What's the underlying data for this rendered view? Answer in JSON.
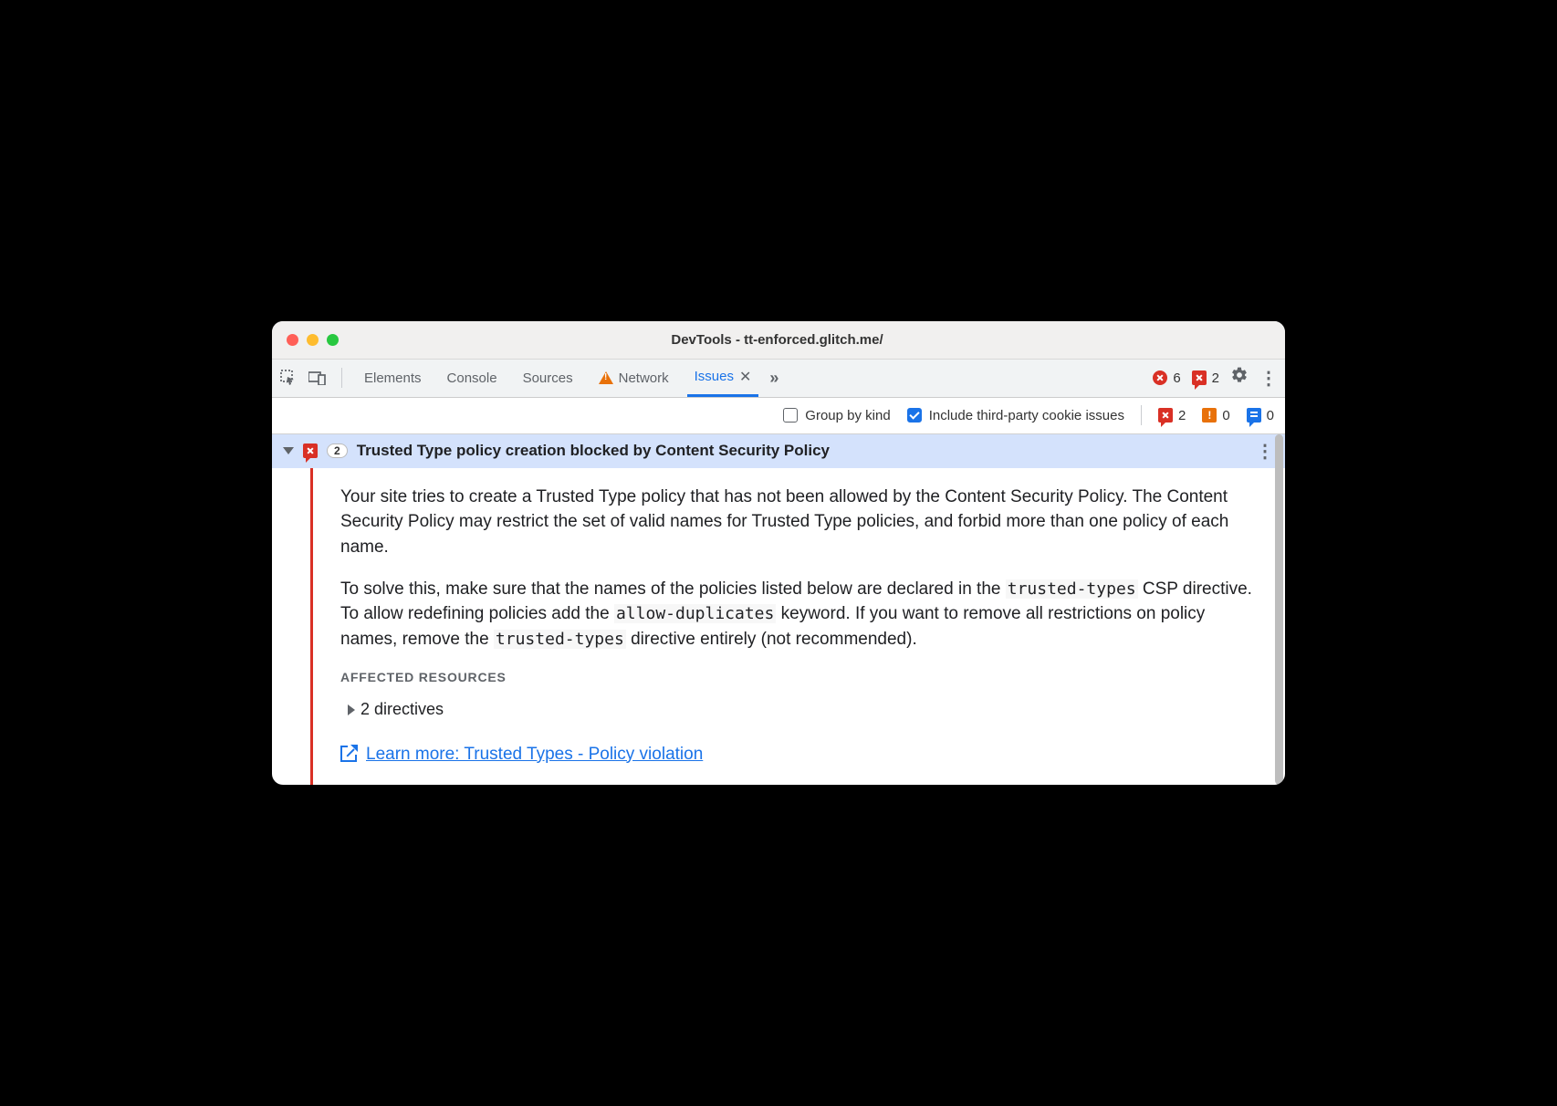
{
  "window": {
    "title": "DevTools - tt-enforced.glitch.me/"
  },
  "tabs": {
    "elements": "Elements",
    "console": "Console",
    "sources": "Sources",
    "network": "Network",
    "issues": "Issues"
  },
  "counters": {
    "errors": "6",
    "issue_errors": "2"
  },
  "filters": {
    "group_by_kind": "Group by kind",
    "include_cookies": "Include third-party cookie issues",
    "counts": {
      "err": "2",
      "warn": "0",
      "info": "0"
    }
  },
  "issue": {
    "count": "2",
    "title": "Trusted Type policy creation blocked by Content Security Policy",
    "para1": "Your site tries to create a Trusted Type policy that has not been allowed by the Content Security Policy. The Content Security Policy may restrict the set of valid names for Trusted Type policies, and forbid more than one policy of each name.",
    "para2a": "To solve this, make sure that the names of the policies listed below are declared in the ",
    "code1": "trusted-types",
    "para2b": " CSP directive. To allow redefining policies add the ",
    "code2": "allow-duplicates",
    "para2c": " keyword. If you want to remove all restrictions on policy names, remove the ",
    "code3": "trusted-types",
    "para2d": " directive entirely (not recommended).",
    "affected_label": "Affected Resources",
    "directives_row": "2 directives",
    "learn_more": "Learn more: Trusted Types - Policy violation"
  }
}
